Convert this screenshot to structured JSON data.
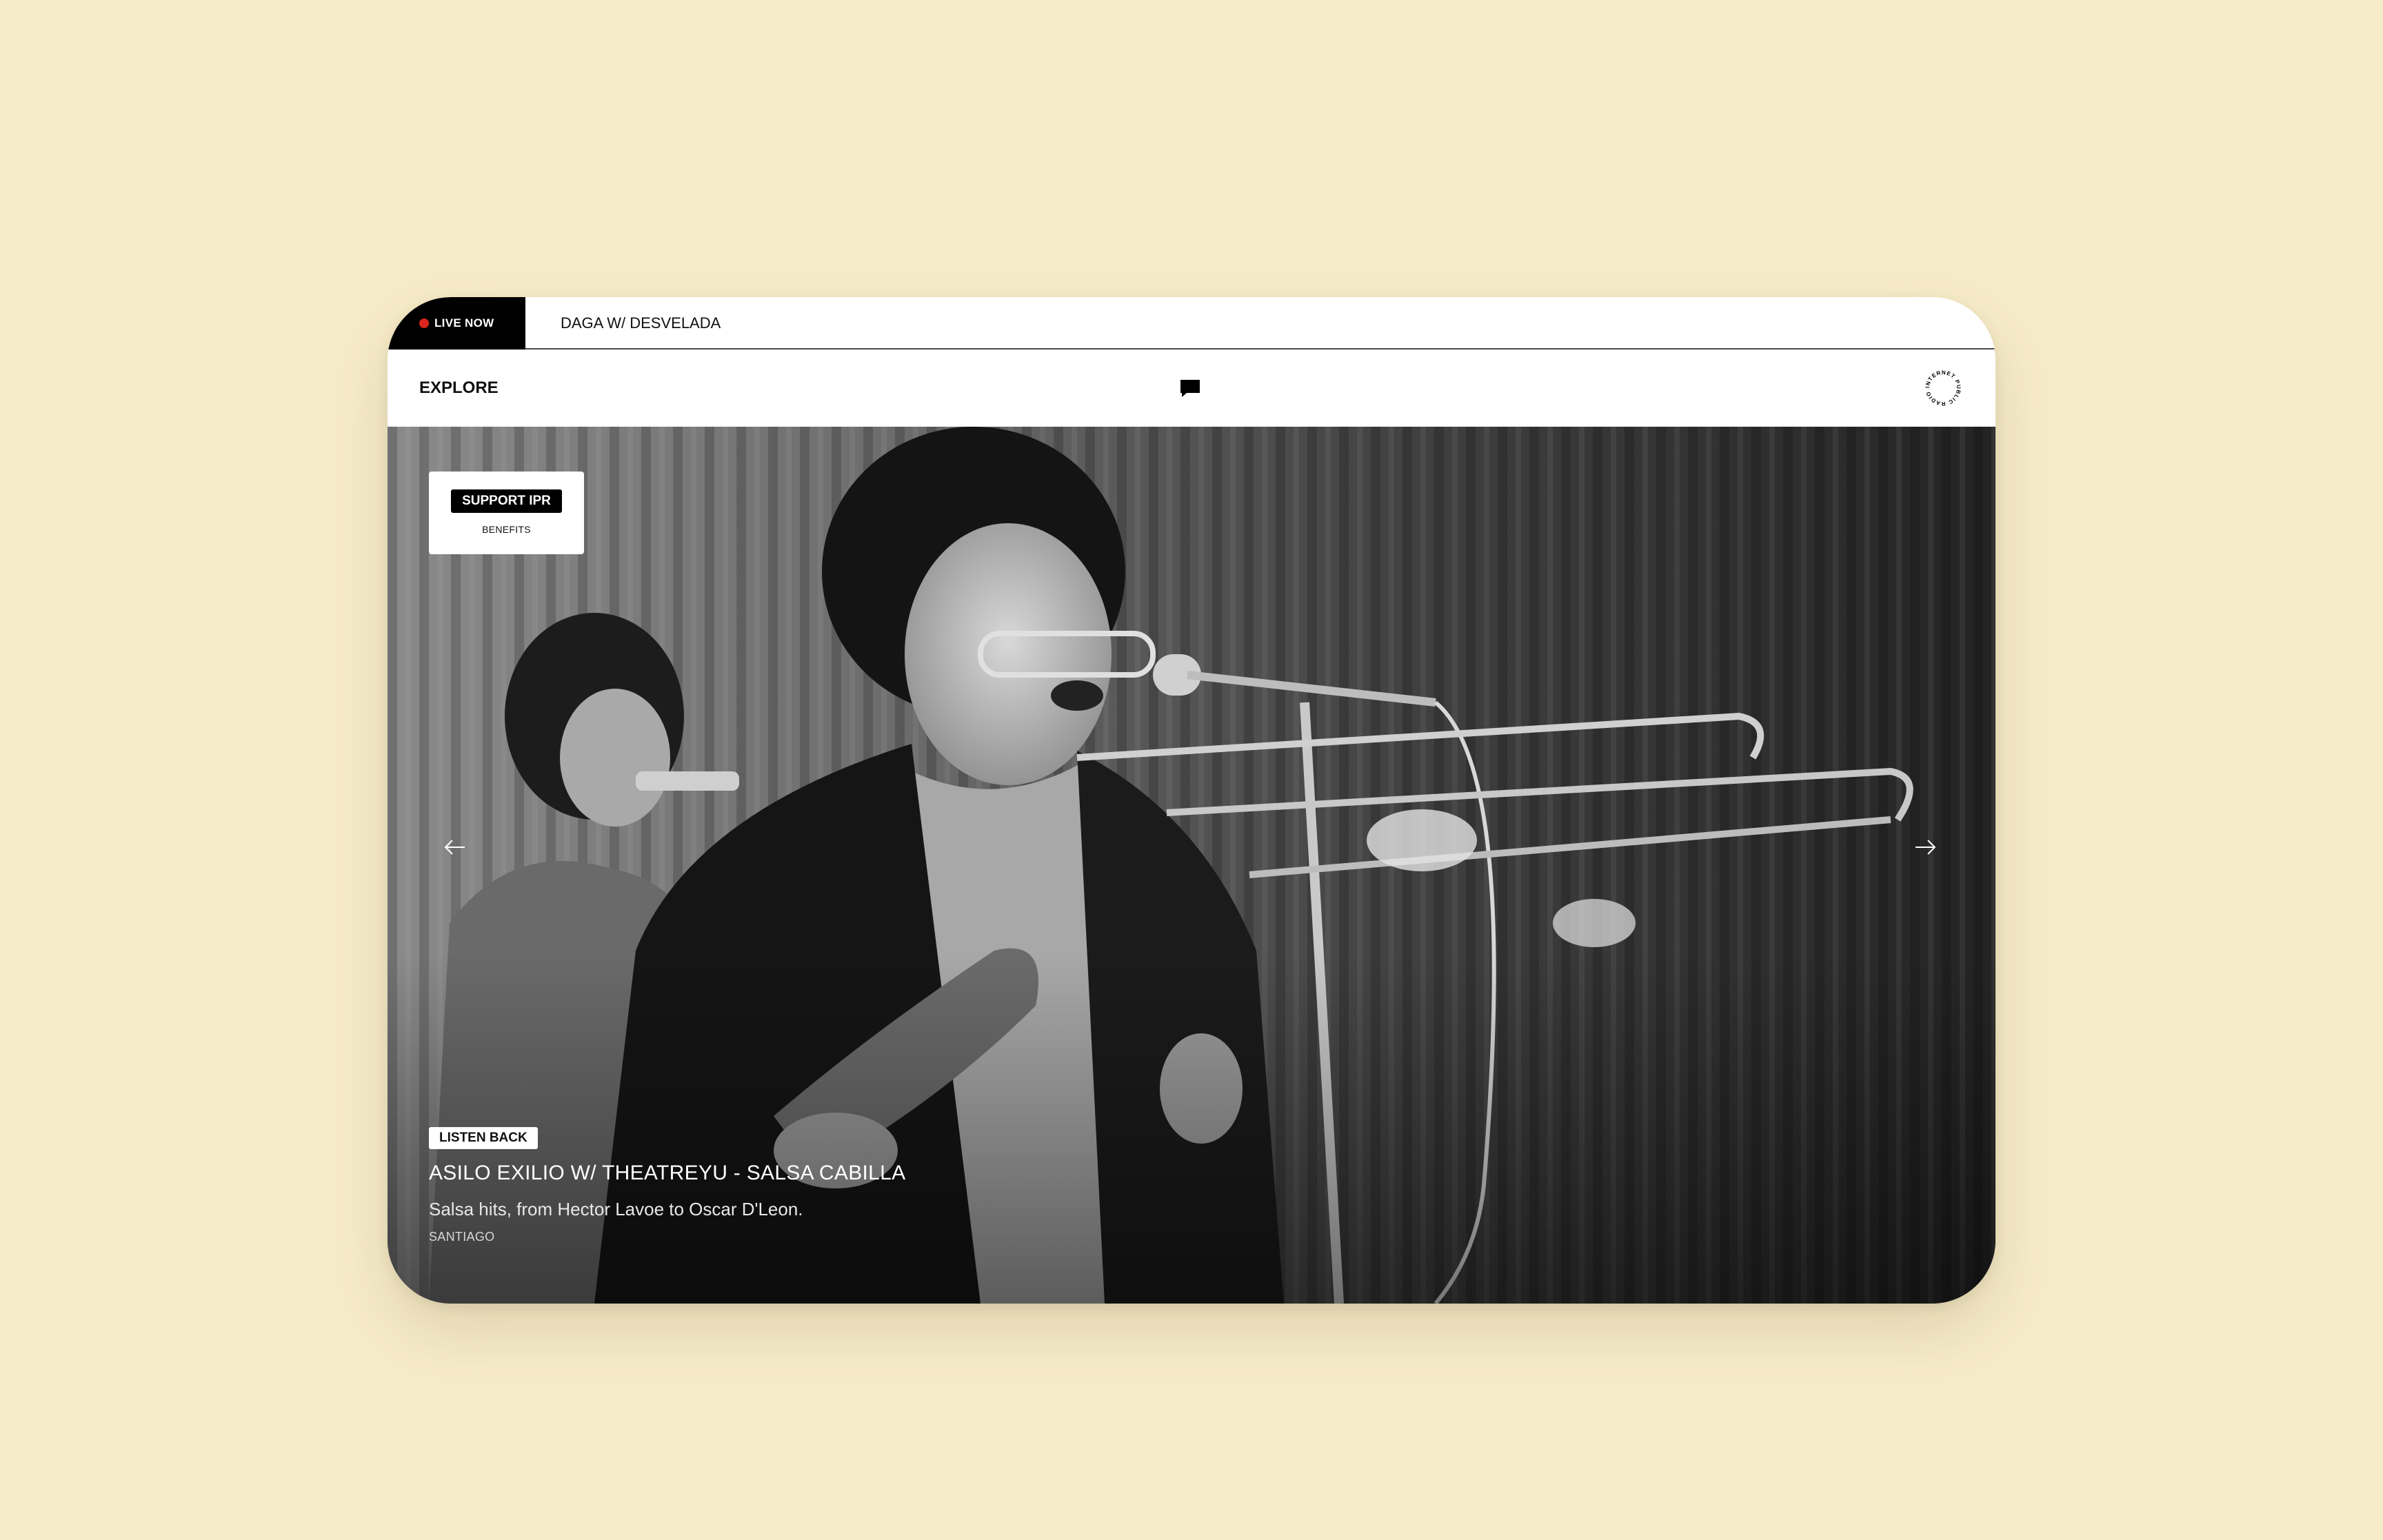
{
  "live": {
    "label": "LIVE NOW",
    "show": "DAGA W/ DESVELADA",
    "dot_color": "#d7261e"
  },
  "nav": {
    "explore": "EXPLORE",
    "chat_icon": "chat-bubble-icon",
    "logo_text": "INTERNET PUBLIC RADIO"
  },
  "support": {
    "button": "SUPPORT IPR",
    "benefits": "BENEFITS"
  },
  "hero": {
    "image": "black-and-white concert photo of a singer at a microphone with trombone players",
    "prev_icon": "arrow-left-icon",
    "next_icon": "arrow-right-icon",
    "tag": "LISTEN BACK",
    "title": "ASILO EXILIO W/ THEATREYU - SALSA CABILLA",
    "description": "Salsa hits, from Hector Lavoe to Oscar D'Leon.",
    "host": "SANTIAGO"
  },
  "colors": {
    "page_background": "#f7ecc8",
    "accent_dark": "#000000"
  }
}
